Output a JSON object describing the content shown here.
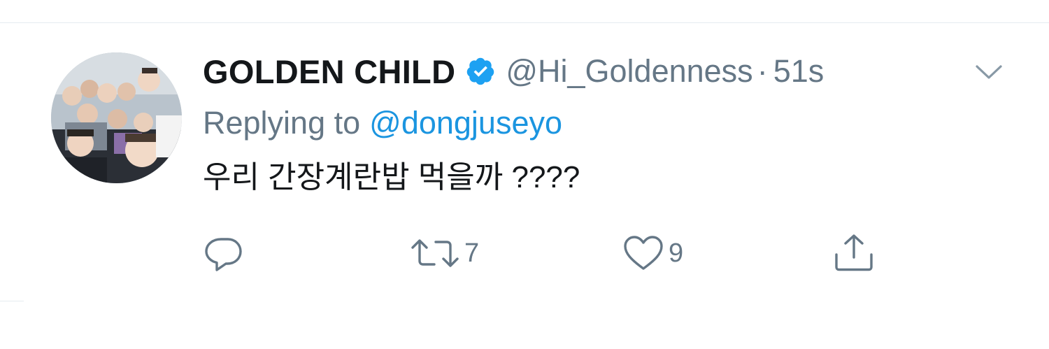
{
  "tweet": {
    "display_name": "GOLDEN CHILD",
    "verified": true,
    "handle": "@Hi_Goldenness",
    "separator": "·",
    "time": "51s",
    "reply_prefix": "Replying to",
    "reply_to": "@dongjuseyo",
    "text": "우리 간장계란밥 먹을까 ????"
  },
  "actions": {
    "reply": {
      "icon": "reply-icon",
      "count": ""
    },
    "retweet": {
      "icon": "retweet-icon",
      "count": "7"
    },
    "like": {
      "icon": "heart-icon",
      "count": "9"
    },
    "share": {
      "icon": "share-icon",
      "count": ""
    }
  },
  "colors": {
    "primary_text": "#14171a",
    "secondary_text": "#657786",
    "link": "#1b95e0",
    "verified_badge": "#1da1f2",
    "divider": "#e6ecf0"
  }
}
